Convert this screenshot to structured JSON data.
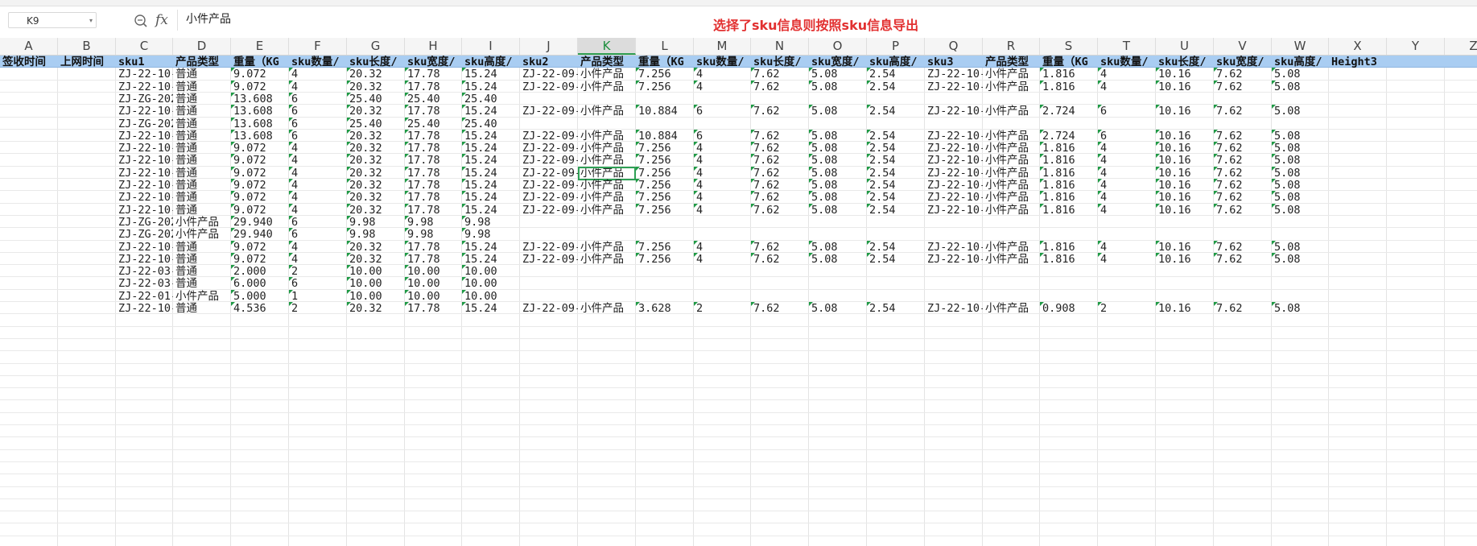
{
  "name_box": {
    "value": "K9"
  },
  "formula_bar": {
    "fx_label": "fx",
    "content": "小件产品"
  },
  "notice": "选择了sku信息则按照sku信息导出",
  "columns": [
    "A",
    "B",
    "C",
    "D",
    "E",
    "F",
    "G",
    "H",
    "I",
    "J",
    "K",
    "L",
    "M",
    "N",
    "O",
    "P",
    "Q",
    "R",
    "S",
    "T",
    "U",
    "V",
    "W",
    "X",
    "Y",
    "Z"
  ],
  "selected_column": "K",
  "active_cell": {
    "row": 9,
    "col": "K"
  },
  "header_row": [
    "签收时间",
    "上网时间",
    "sku1",
    "产品类型",
    "重量（KG",
    "sku数量/",
    "sku长度/",
    "sku宽度/",
    "sku高度/",
    "sku2",
    "产品类型",
    "重量（KG",
    "sku数量/",
    "sku长度/",
    "sku宽度/",
    "sku高度/",
    "sku3",
    "产品类型",
    "重量（KG",
    "sku数量/",
    "sku长度/",
    "sku宽度/",
    "sku高度/",
    "Height3"
  ],
  "rows": [
    [
      "",
      "",
      "ZJ-22-10-",
      "普通",
      "9.072",
      "4",
      "20.32",
      "17.78",
      "15.24",
      "ZJ-22-09-",
      "小件产品",
      "7.256",
      "4",
      "7.62",
      "5.08",
      "2.54",
      "ZJ-22-10-",
      "小件产品",
      "1.816",
      "4",
      "10.16",
      "7.62",
      "5.08",
      ""
    ],
    [
      "",
      "",
      "ZJ-22-10-",
      "普通",
      "9.072",
      "4",
      "20.32",
      "17.78",
      "15.24",
      "ZJ-22-09-",
      "小件产品",
      "7.256",
      "4",
      "7.62",
      "5.08",
      "2.54",
      "ZJ-22-10-",
      "小件产品",
      "1.816",
      "4",
      "10.16",
      "7.62",
      "5.08",
      ""
    ],
    [
      "",
      "",
      "ZJ-ZG-202",
      "普通",
      "13.608",
      "6",
      "25.40",
      "25.40",
      "25.40",
      "",
      "",
      "",
      "",
      "",
      "",
      "",
      "",
      "",
      "",
      "",
      "",
      "",
      "",
      ""
    ],
    [
      "",
      "",
      "ZJ-22-10-",
      "普通",
      "13.608",
      "6",
      "20.32",
      "17.78",
      "15.24",
      "ZJ-22-09-",
      "小件产品",
      "10.884",
      "6",
      "7.62",
      "5.08",
      "2.54",
      "ZJ-22-10-",
      "小件产品",
      "2.724",
      "6",
      "10.16",
      "7.62",
      "5.08",
      ""
    ],
    [
      "",
      "",
      "ZJ-ZG-202",
      "普通",
      "13.608",
      "6",
      "25.40",
      "25.40",
      "25.40",
      "",
      "",
      "",
      "",
      "",
      "",
      "",
      "",
      "",
      "",
      "",
      "",
      "",
      "",
      ""
    ],
    [
      "",
      "",
      "ZJ-22-10-",
      "普通",
      "13.608",
      "6",
      "20.32",
      "17.78",
      "15.24",
      "ZJ-22-09-",
      "小件产品",
      "10.884",
      "6",
      "7.62",
      "5.08",
      "2.54",
      "ZJ-22-10-",
      "小件产品",
      "2.724",
      "6",
      "10.16",
      "7.62",
      "5.08",
      ""
    ],
    [
      "",
      "",
      "ZJ-22-10-",
      "普通",
      "9.072",
      "4",
      "20.32",
      "17.78",
      "15.24",
      "ZJ-22-09-",
      "小件产品",
      "7.256",
      "4",
      "7.62",
      "5.08",
      "2.54",
      "ZJ-22-10-",
      "小件产品",
      "1.816",
      "4",
      "10.16",
      "7.62",
      "5.08",
      ""
    ],
    [
      "",
      "",
      "ZJ-22-10-",
      "普通",
      "9.072",
      "4",
      "20.32",
      "17.78",
      "15.24",
      "ZJ-22-09-",
      "小件产品",
      "7.256",
      "4",
      "7.62",
      "5.08",
      "2.54",
      "ZJ-22-10-",
      "小件产品",
      "1.816",
      "4",
      "10.16",
      "7.62",
      "5.08",
      ""
    ],
    [
      "",
      "",
      "ZJ-22-10-",
      "普通",
      "9.072",
      "4",
      "20.32",
      "17.78",
      "15.24",
      "ZJ-22-09-",
      "小件产品",
      "7.256",
      "4",
      "7.62",
      "5.08",
      "2.54",
      "ZJ-22-10-",
      "小件产品",
      "1.816",
      "4",
      "10.16",
      "7.62",
      "5.08",
      ""
    ],
    [
      "",
      "",
      "ZJ-22-10-",
      "普通",
      "9.072",
      "4",
      "20.32",
      "17.78",
      "15.24",
      "ZJ-22-09-",
      "小件产品",
      "7.256",
      "4",
      "7.62",
      "5.08",
      "2.54",
      "ZJ-22-10-",
      "小件产品",
      "1.816",
      "4",
      "10.16",
      "7.62",
      "5.08",
      ""
    ],
    [
      "",
      "",
      "ZJ-22-10-",
      "普通",
      "9.072",
      "4",
      "20.32",
      "17.78",
      "15.24",
      "ZJ-22-09-",
      "小件产品",
      "7.256",
      "4",
      "7.62",
      "5.08",
      "2.54",
      "ZJ-22-10-",
      "小件产品",
      "1.816",
      "4",
      "10.16",
      "7.62",
      "5.08",
      ""
    ],
    [
      "",
      "",
      "ZJ-22-10-",
      "普通",
      "9.072",
      "4",
      "20.32",
      "17.78",
      "15.24",
      "ZJ-22-09-",
      "小件产品",
      "7.256",
      "4",
      "7.62",
      "5.08",
      "2.54",
      "ZJ-22-10-",
      "小件产品",
      "1.816",
      "4",
      "10.16",
      "7.62",
      "5.08",
      ""
    ],
    [
      "",
      "",
      "ZJ-ZG-202",
      "小件产品",
      "29.940",
      "6",
      "9.98",
      "9.98",
      "9.98",
      "",
      "",
      "",
      "",
      "",
      "",
      "",
      "",
      "",
      "",
      "",
      "",
      "",
      "",
      ""
    ],
    [
      "",
      "",
      "ZJ-ZG-202",
      "小件产品",
      "29.940",
      "6",
      "9.98",
      "9.98",
      "9.98",
      "",
      "",
      "",
      "",
      "",
      "",
      "",
      "",
      "",
      "",
      "",
      "",
      "",
      "",
      ""
    ],
    [
      "",
      "",
      "ZJ-22-10-",
      "普通",
      "9.072",
      "4",
      "20.32",
      "17.78",
      "15.24",
      "ZJ-22-09-",
      "小件产品",
      "7.256",
      "4",
      "7.62",
      "5.08",
      "2.54",
      "ZJ-22-10-",
      "小件产品",
      "1.816",
      "4",
      "10.16",
      "7.62",
      "5.08",
      ""
    ],
    [
      "",
      "",
      "ZJ-22-10-",
      "普通",
      "9.072",
      "4",
      "20.32",
      "17.78",
      "15.24",
      "ZJ-22-09-",
      "小件产品",
      "7.256",
      "4",
      "7.62",
      "5.08",
      "2.54",
      "ZJ-22-10-",
      "小件产品",
      "1.816",
      "4",
      "10.16",
      "7.62",
      "5.08",
      ""
    ],
    [
      "",
      "",
      "ZJ-22-03-",
      "普通",
      "2.000",
      "2",
      "10.00",
      "10.00",
      "10.00",
      "",
      "",
      "",
      "",
      "",
      "",
      "",
      "",
      "",
      "",
      "",
      "",
      "",
      "",
      ""
    ],
    [
      "",
      "",
      "ZJ-22-03-",
      "普通",
      "6.000",
      "6",
      "10.00",
      "10.00",
      "10.00",
      "",
      "",
      "",
      "",
      "",
      "",
      "",
      "",
      "",
      "",
      "",
      "",
      "",
      "",
      ""
    ],
    [
      "",
      "",
      "ZJ-22-01-",
      "小件产品",
      "5.000",
      "1",
      "10.00",
      "10.00",
      "10.00",
      "",
      "",
      "",
      "",
      "",
      "",
      "",
      "",
      "",
      "",
      "",
      "",
      "",
      "",
      ""
    ],
    [
      "",
      "",
      "ZJ-22-10-",
      "普通",
      "4.536",
      "2",
      "20.32",
      "17.78",
      "15.24",
      "ZJ-22-09-",
      "小件产品",
      "3.628",
      "2",
      "7.62",
      "5.08",
      "2.54",
      "ZJ-22-10-",
      "小件产品",
      "0.908",
      "2",
      "10.16",
      "7.62",
      "5.08",
      ""
    ]
  ],
  "numeric_marked_columns": [
    "E",
    "F",
    "G",
    "H",
    "I",
    "L",
    "M",
    "N",
    "O",
    "P",
    "S",
    "T",
    "U",
    "V",
    "W"
  ],
  "colors": {
    "header_fill": "#a9cdf2",
    "notice": "#e23030",
    "selection": "#2ea055"
  }
}
